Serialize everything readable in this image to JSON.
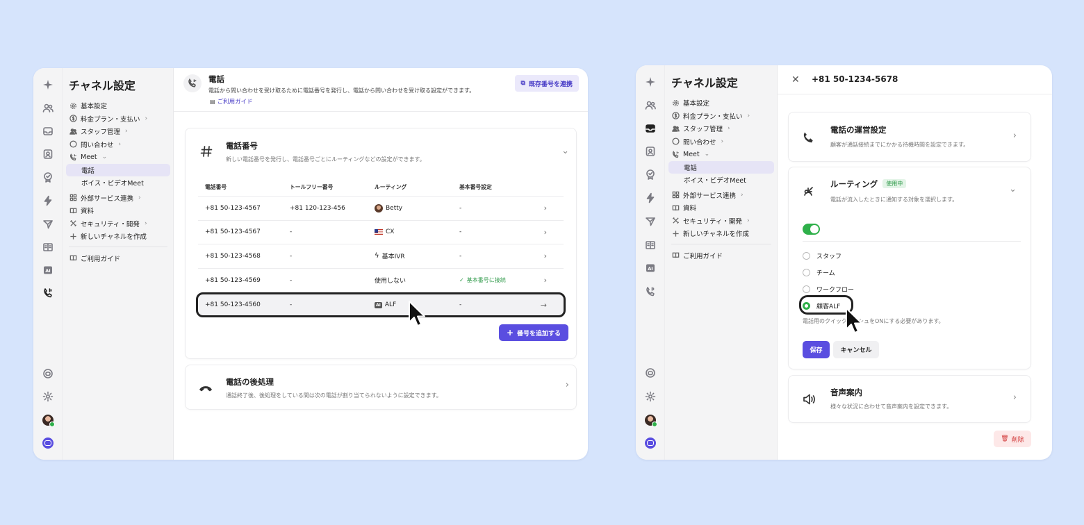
{
  "left_window": {
    "sidebar": {
      "title": "チャネル設定",
      "items": [
        {
          "label": "基本設定",
          "icon": "gear-icon"
        },
        {
          "label": "料金プラン・支払い",
          "icon": "dollar-icon"
        },
        {
          "label": "スタッフ管理",
          "icon": "users-icon"
        },
        {
          "label": "問い合わせ",
          "icon": "chat-icon"
        },
        {
          "label": "Meet",
          "icon": "phone-icon"
        },
        {
          "label": "電話",
          "icon": ""
        },
        {
          "label": "ボイス・ビデオMeet",
          "icon": ""
        },
        {
          "label": "外部サービス連携",
          "icon": "grid-icon"
        },
        {
          "label": "資料",
          "icon": "book-icon"
        },
        {
          "label": "セキュリティ・開発",
          "icon": "tools-icon"
        },
        {
          "label": "新しいチャネルを作成",
          "icon": "plus-icon"
        }
      ],
      "guide": "ご利用ガイド"
    },
    "header": {
      "title": "電話",
      "description": "電話から問い合わせを受け取るために電話番号を発行し、電話から問い合わせを受け取る設定ができます。",
      "guide_link": "ご利用ガイド",
      "link_button": "既存番号を連携"
    },
    "numbers_card": {
      "title": "電話番号",
      "description": "新しい電話番号を発行し、電話番号ごとにルーティングなどの設定ができます。",
      "columns": [
        "電話番号",
        "トールフリー番号",
        "ルーティング",
        "基本番号設定"
      ],
      "rows": [
        {
          "number": "+81 50-123-4567",
          "tollfree": "+81 120-123-456",
          "routing": "Betty",
          "routing_icon": "avatar",
          "base": "-"
        },
        {
          "number": "+81 50-123-4567",
          "tollfree": "-",
          "routing": "CX",
          "routing_icon": "us-flag-icon",
          "base": "-"
        },
        {
          "number": "+81 50-123-4568",
          "tollfree": "-",
          "routing": "基本IVR",
          "routing_icon": "bolt-icon",
          "base": "-"
        },
        {
          "number": "+81 50-123-4569",
          "tollfree": "-",
          "routing": "使用しない",
          "routing_icon": "",
          "base": "基本番号に接続"
        },
        {
          "number": "+81 50-123-4560",
          "tollfree": "-",
          "routing": "ALF",
          "routing_icon": "ai-icon",
          "base": "-"
        }
      ],
      "add_button": "番号を追加する"
    },
    "post_card": {
      "title": "電話の後処理",
      "description": "通話終了後、後処理をしている間は次の電話が割り当てられないように設定できます。"
    }
  },
  "right_window": {
    "sidebar": {
      "title": "チャネル設定",
      "items": [
        {
          "label": "基本設定"
        },
        {
          "label": "料金プラン・支払い"
        },
        {
          "label": "スタッフ管理"
        },
        {
          "label": "問い合わせ"
        },
        {
          "label": "Meet"
        },
        {
          "label": "電話"
        },
        {
          "label": "ボイス・ビデオMeet"
        },
        {
          "label": "外部サービス連携"
        },
        {
          "label": "資料"
        },
        {
          "label": "セキュリティ・開発"
        },
        {
          "label": "新しいチャネルを作成"
        }
      ],
      "guide": "ご利用ガイド"
    },
    "header": {
      "title": "+81 50-1234-5678"
    },
    "ops_card": {
      "title": "電話の運営設定",
      "description": "顧客が通話接続までにかかる待機時間を設定できます。"
    },
    "routing_card": {
      "title": "ルーティング",
      "badge": "使用中",
      "description": "電話が流入したときに通知する対象を選択します。",
      "options": [
        "スタッフ",
        "チーム",
        "ワークフロー",
        "顧客ALF"
      ],
      "selected": "顧客ALF",
      "note": "電話用のクイックプッシュをONにする必要があります。",
      "save": "保存",
      "cancel": "キャンセル"
    },
    "voice_card": {
      "title": "音声案内",
      "description": "様々な状況に合わせて音声案内を設定できます。"
    },
    "delete_button": "削除"
  },
  "colors": {
    "accent": "#5a4ee0",
    "success": "#2fb04a",
    "background": "#d6e4fc",
    "danger": "#d23a3a"
  }
}
